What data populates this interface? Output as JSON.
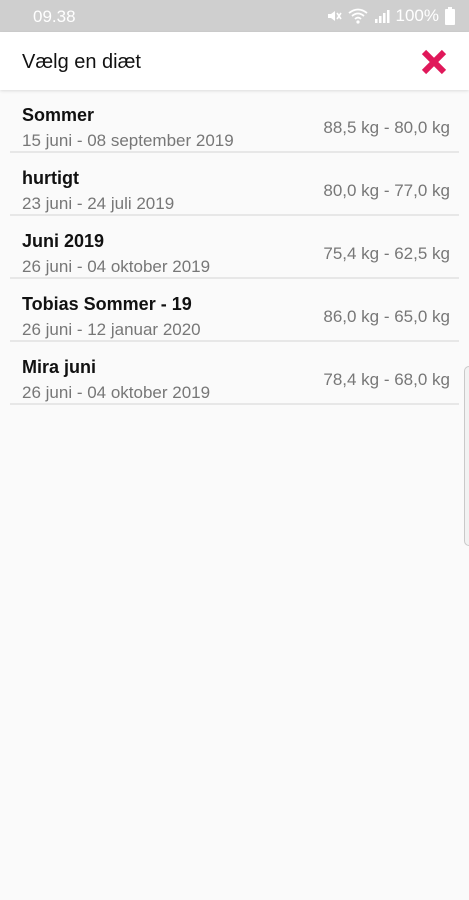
{
  "status_bar": {
    "time": "09.38",
    "battery": "100%",
    "icons": [
      "mute-icon",
      "wifi-icon",
      "signal-icon",
      "battery-icon"
    ]
  },
  "header": {
    "title": "Vælg en diæt",
    "close_icon": "close-icon",
    "close_color": "#e0185a"
  },
  "diets": [
    {
      "name": "Sommer",
      "dates": "15 juni - 08 september 2019",
      "weight": "88,5 kg - 80,0 kg"
    },
    {
      "name": "hurtigt",
      "dates": "23 juni - 24 juli 2019",
      "weight": "80,0 kg - 77,0 kg"
    },
    {
      "name": "Juni 2019",
      "dates": "26 juni - 04 oktober 2019",
      "weight": "75,4 kg - 62,5 kg"
    },
    {
      "name": "Tobias Sommer - 19",
      "dates": "26 juni - 12 januar 2020",
      "weight": "86,0 kg - 65,0 kg"
    },
    {
      "name": "Mira juni",
      "dates": "26 juni - 04 oktober 2019",
      "weight": "78,4 kg - 68,0 kg"
    }
  ]
}
